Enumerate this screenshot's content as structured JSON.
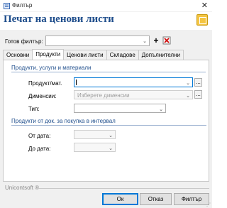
{
  "window": {
    "title": "Филтър"
  },
  "header": {
    "title": "Печат на ценови листи"
  },
  "ready_filter": {
    "label": "Готов филтър:",
    "value": ""
  },
  "tabs": [
    {
      "label": "Основни",
      "active": false
    },
    {
      "label": "Продукти",
      "active": true
    },
    {
      "label": "Ценови листи",
      "active": false
    },
    {
      "label": "Складове",
      "active": false
    },
    {
      "label": "Допълнителни",
      "active": false
    }
  ],
  "section_products": {
    "title": "Продукти, услуги и материали",
    "product_label": "Продукт/мат.",
    "product_value": "",
    "dimensions_label": "Дименсии:",
    "dimensions_placeholder": "Изберете дименсии",
    "type_label": "Тип:",
    "type_value": ""
  },
  "section_docs": {
    "title": "Продукти от док. за покупка в интервал",
    "from_label": "От дата:",
    "to_label": "До дата:"
  },
  "footer": {
    "brand": "Unicontsoft ®",
    "ok_label": "Ок",
    "cancel_label": "Отказ",
    "filter_label": "Филтър"
  },
  "colors": {
    "title": "#1f4e8c",
    "accent_icon": "#f4c542"
  }
}
